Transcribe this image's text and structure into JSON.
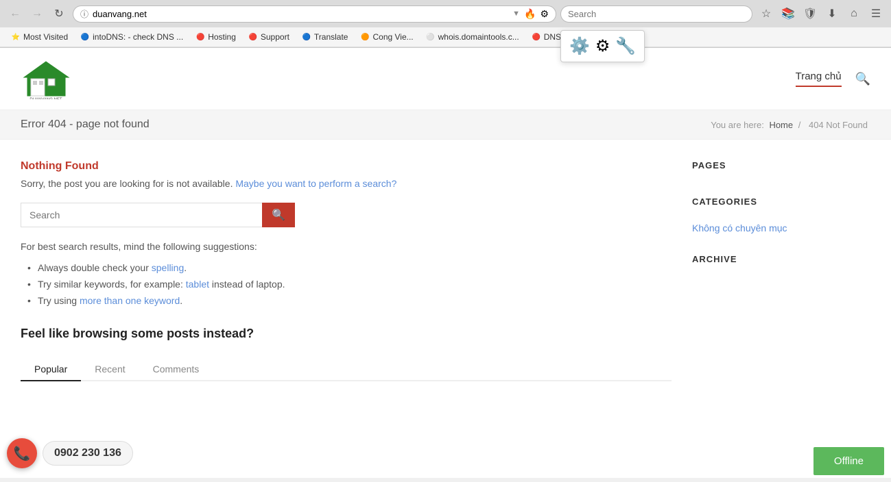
{
  "browser": {
    "back_disabled": true,
    "forward_disabled": true,
    "url": "duanvang.net",
    "search_placeholder": "Search",
    "search_value": "",
    "bookmarks": [
      {
        "label": "Most Visited",
        "favicon": "⭐"
      },
      {
        "label": "intoDNS: - check DNS ...",
        "favicon": "🔵"
      },
      {
        "label": "Hosting",
        "favicon": "🔴"
      },
      {
        "label": "Support",
        "favicon": "🔴"
      },
      {
        "label": "Translate",
        "favicon": "🔵"
      },
      {
        "label": "Cong Vie...",
        "favicon": "🟠"
      },
      {
        "label": "whois.domaintools.c...",
        "favicon": "⚪"
      },
      {
        "label": "DNS watch",
        "favicon": "🔴"
      }
    ],
    "gear_popup_visible": true
  },
  "site": {
    "logo_text": "DUANVANG.NET",
    "nav_items": [
      {
        "label": "Trang chủ",
        "active": true
      }
    ],
    "page_title": "Error 404 - page not found",
    "breadcrumb": {
      "prefix": "You are here:",
      "items": [
        "Home",
        "404 Not Found"
      ],
      "separator": "/"
    }
  },
  "content": {
    "nothing_found_title": "Nothing Found",
    "nothing_found_desc_before": "Sorry, the post you are looking for is not available.",
    "nothing_found_desc_link": "Maybe you want to perform a search?",
    "search_placeholder": "Search",
    "search_button_icon": "🔍",
    "tips_intro": "For best search results, mind the following suggestions:",
    "tips": [
      {
        "text_before": "Always double check your ",
        "link": "spelling",
        "text_after": "."
      },
      {
        "text_before": "Try similar keywords, for example: ",
        "link": "tablet",
        "text_after": " instead of laptop."
      },
      {
        "text_before": "Try using ",
        "link": "more than one keyword",
        "text_after": "."
      }
    ],
    "browse_heading": "Feel like browsing some posts instead?",
    "tabs": [
      {
        "label": "Popular",
        "active": true
      },
      {
        "label": "Recent",
        "active": false
      },
      {
        "label": "Comments",
        "active": false
      }
    ]
  },
  "sidebar": {
    "sections": [
      {
        "heading": "PAGES",
        "items": []
      },
      {
        "heading": "CATEGORIES",
        "items": [
          {
            "label": "Không có chuyên mục",
            "link": true
          }
        ]
      },
      {
        "heading": "ARCHIVE",
        "items": []
      }
    ]
  },
  "phone": {
    "number": "0902 230 136"
  },
  "offline": {
    "label": "Offline"
  }
}
